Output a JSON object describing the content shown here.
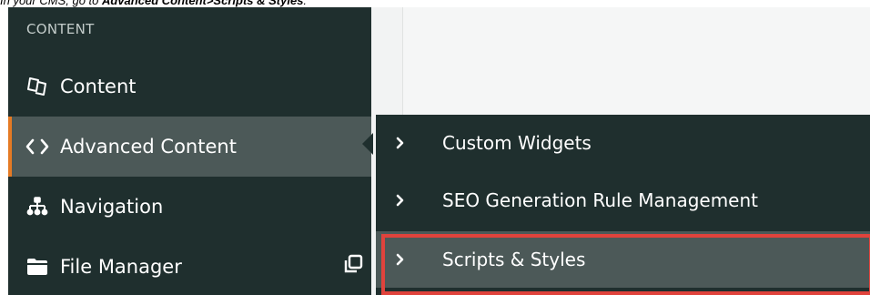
{
  "caption": {
    "prefix": "In your CMS, go to ",
    "path": "Advanced Content>Scripts & Styles",
    "suffix": "."
  },
  "sidebar": {
    "section_label": "CONTENT",
    "items": [
      {
        "label": "Content",
        "icon": "documents-icon"
      },
      {
        "label": "Advanced Content",
        "icon": "code-brackets-icon",
        "active": true
      },
      {
        "label": "Navigation",
        "icon": "sitemap-icon"
      },
      {
        "label": "File Manager",
        "icon": "folder-icon",
        "extra_icon": "popout-icon"
      }
    ]
  },
  "submenu": {
    "items": [
      {
        "label": "Custom Widgets"
      },
      {
        "label": "SEO Generation Rule Management"
      },
      {
        "label": "Scripts & Styles",
        "highlighted": true
      }
    ]
  },
  "colors": {
    "sidebar_bg": "#1f2f2e",
    "active_bg": "#4c5958",
    "active_accent": "#e57a24",
    "highlight_border": "#e0433c"
  }
}
